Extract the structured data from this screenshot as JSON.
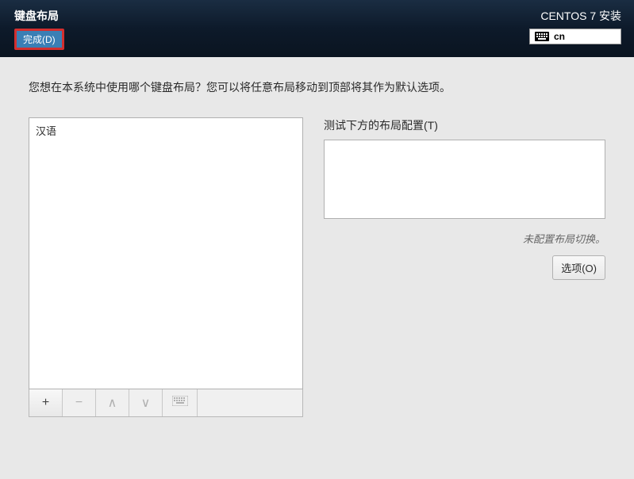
{
  "header": {
    "title": "键盘布局",
    "done_label": "完成(D)",
    "product": "CENTOS 7 安装",
    "locale": "cn"
  },
  "content": {
    "instruction": "您想在本系统中使用哪个键盘布局？您可以将任意布局移动到顶部将其作为默认选项。",
    "layout_items": [
      "汉语"
    ],
    "test_label": "测试下方的布局配置(T)",
    "status_text": "未配置布局切换。",
    "options_label": "选项(O)"
  },
  "toolbar": {
    "add": "+",
    "remove": "−",
    "up": "∧",
    "down": "∨"
  }
}
